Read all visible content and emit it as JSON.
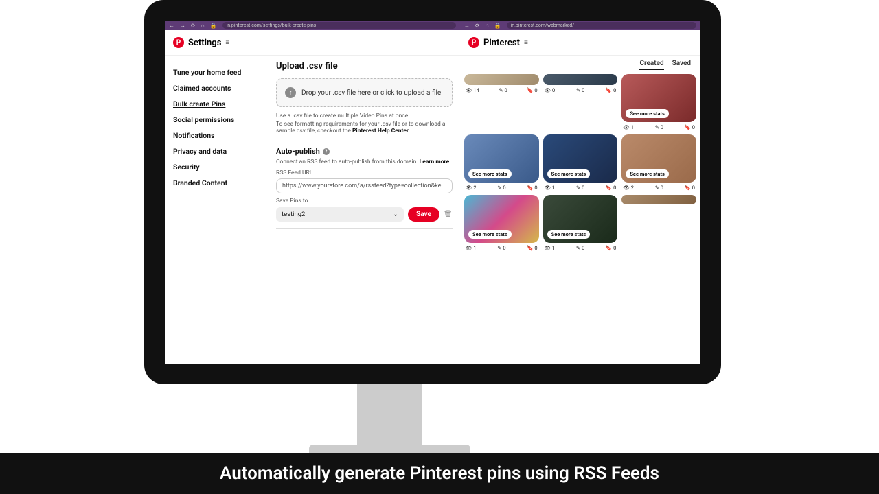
{
  "caption": "Automatically generate Pinterest pins using RSS Feeds",
  "browserA": {
    "url": "in.pinterest.com/settings/bulk-create-pins"
  },
  "browserB": {
    "url": "in.pinterest.com/webmarked/"
  },
  "headerA": {
    "title": "Settings"
  },
  "headerB": {
    "title": "Pinterest"
  },
  "sidebar": {
    "items": [
      {
        "label": "Tune your home feed"
      },
      {
        "label": "Claimed accounts"
      },
      {
        "label": "Bulk create Pins"
      },
      {
        "label": "Social permissions"
      },
      {
        "label": "Notifications"
      },
      {
        "label": "Privacy and data"
      },
      {
        "label": "Security"
      },
      {
        "label": "Branded Content"
      }
    ]
  },
  "upload": {
    "title": "Upload .csv file",
    "drop": "Drop your .csv file here or click to upload a file",
    "help1": "Use a .csv file to create multiple Video Pins at once.",
    "help2_a": "To see formatting requirements for your .csv file or to download a sample csv file, checkout the ",
    "help2_b": "Pinterest Help Center"
  },
  "auto": {
    "title": "Auto-publish",
    "desc_a": "Connect an RSS feed to auto-publish from this domain. ",
    "desc_b": "Learn more",
    "url_label": "RSS Feed URL",
    "url_value": "https://www.yourstore.com/a/rssfeed?type=collection&ke...",
    "save_label": "Save Pins to",
    "board": "testing2",
    "save_btn": "Save"
  },
  "tabs": {
    "created": "Created",
    "saved": "Saved"
  },
  "pins": [
    {
      "h": "r0",
      "bg": "bg-a",
      "sms": false,
      "stats": {
        "v": "14",
        "e": "0",
        "s": "0"
      }
    },
    {
      "h": "r0",
      "bg": "bg-b",
      "sms": false,
      "stats": {
        "v": "0",
        "e": "0",
        "s": "0"
      }
    },
    {
      "h": "r1",
      "bg": "bg-c",
      "sms": true,
      "stats": {
        "v": "1",
        "e": "0",
        "s": "0"
      }
    },
    {
      "h": "r1",
      "bg": "bg-d",
      "sms": true,
      "stats": {
        "v": "2",
        "e": "0",
        "s": "0"
      }
    },
    {
      "h": "r1",
      "bg": "bg-e",
      "sms": true,
      "stats": {
        "v": "1",
        "e": "0",
        "s": "0"
      }
    },
    {
      "h": "r2",
      "bg": "bg-i",
      "sms": true,
      "stats": {
        "v": "2",
        "e": "0",
        "s": "0"
      }
    },
    {
      "h": "r2",
      "bg": "bg-g",
      "sms": true,
      "stats": {
        "v": "1",
        "e": "0",
        "s": "0"
      }
    },
    {
      "h": "r2",
      "bg": "bg-h",
      "sms": true,
      "stats": {
        "v": "1",
        "e": "0",
        "s": "0"
      }
    },
    {
      "h": "r3",
      "bg": "bg-j",
      "sms": false,
      "stats": null
    }
  ],
  "sms_label": "See more stats"
}
